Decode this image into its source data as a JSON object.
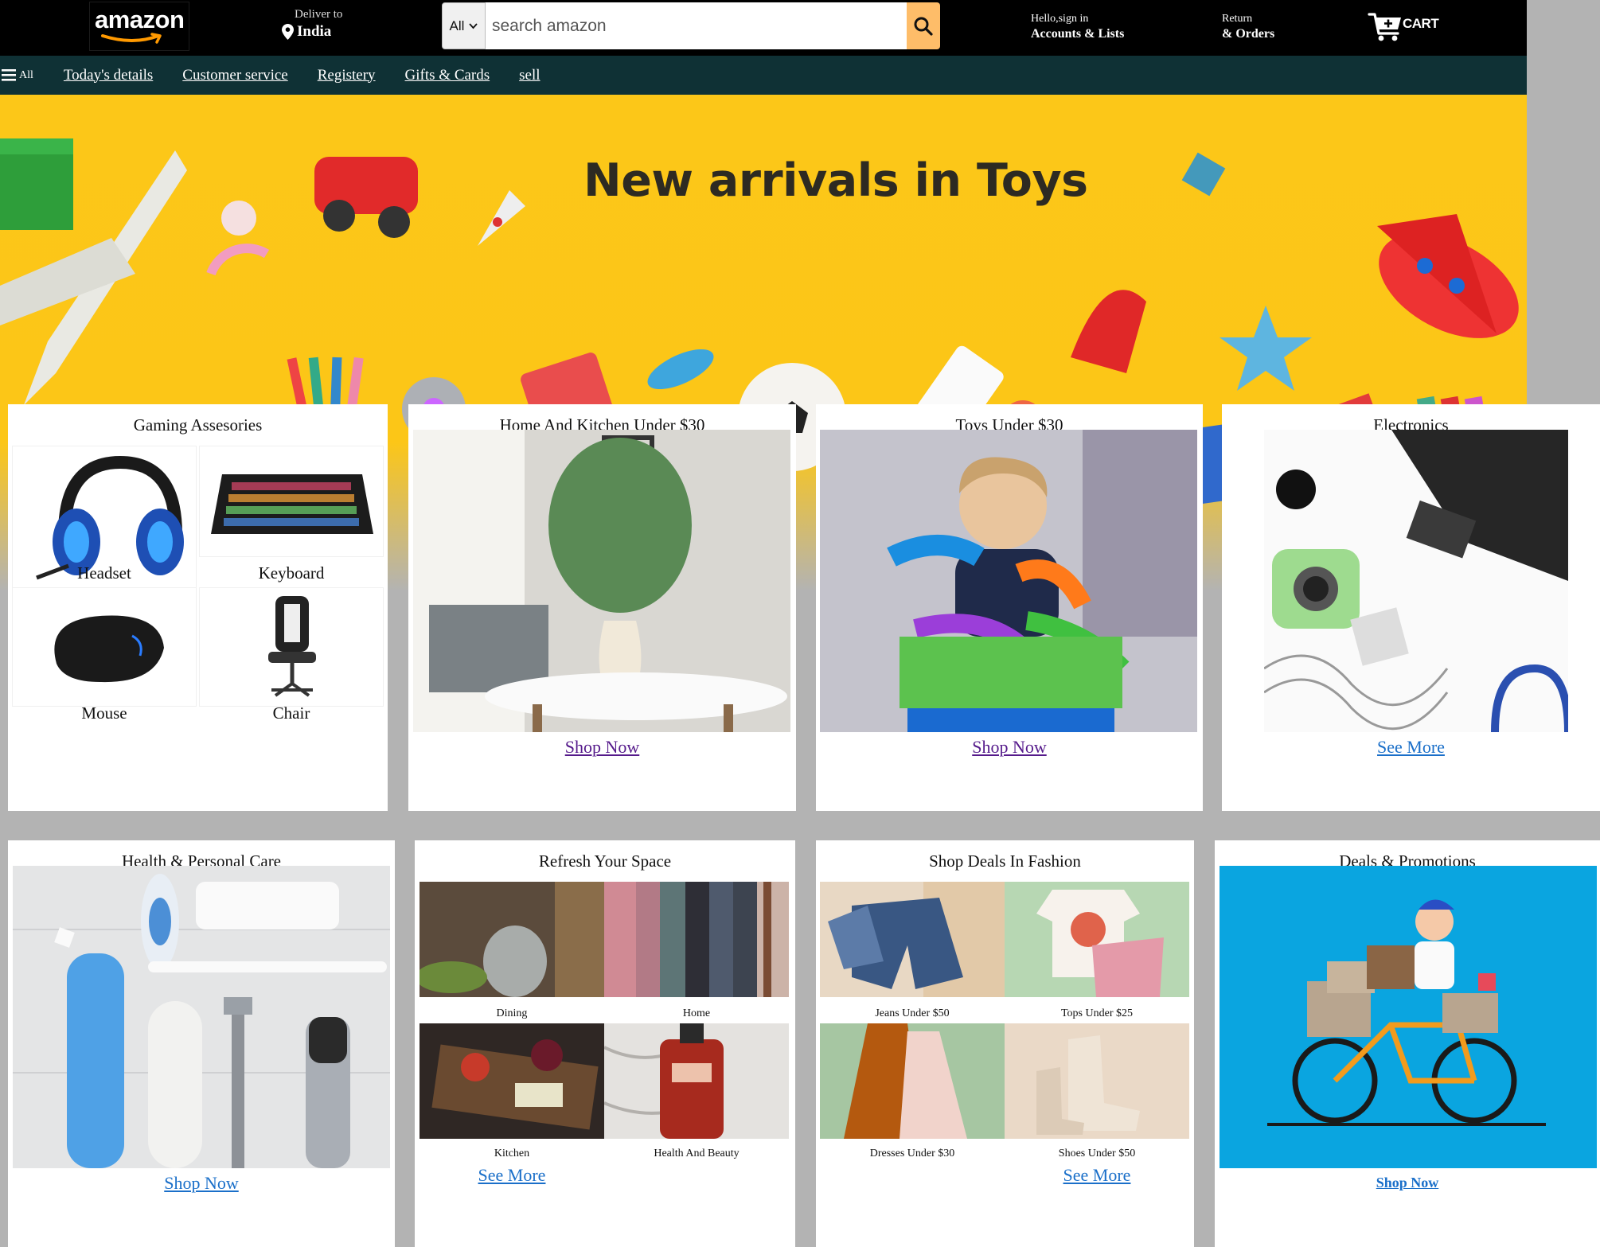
{
  "header": {
    "logo_text": "amazon",
    "deliver_label": "Deliver to",
    "deliver_location": "India",
    "search_category": "All",
    "search_placeholder": "search amazon",
    "account_line1": "Hello,sign in",
    "account_line2": "Accounts & Lists",
    "returns_line1": "Return",
    "returns_line2": "& Orders",
    "cart_label": "CART"
  },
  "subnav": {
    "all_label": "All",
    "links": [
      "Today's details",
      "Customer service",
      "Registery",
      "Gifts & Cards",
      "sell"
    ]
  },
  "hero": {
    "title": "New arrivals in Toys"
  },
  "cards": {
    "gaming": {
      "title": "Gaming Assesories",
      "items": [
        "Headset",
        "Keyboard",
        "Mouse",
        "Chair"
      ]
    },
    "home_kitchen": {
      "title": "Home And Kitchen Under $30",
      "link": "Shop Now"
    },
    "toys": {
      "title": "Toys Under $30",
      "link": "Shop Now"
    },
    "electronics": {
      "title": "Electronics",
      "link": "See More"
    },
    "health": {
      "title": "Health & Personal Care",
      "link": "Shop Now"
    },
    "refresh": {
      "title": "Refresh Your Space",
      "items": [
        "Dining",
        "Home",
        "Kitchen",
        "Health And Beauty"
      ],
      "link": "See More"
    },
    "fashion": {
      "title": "Shop Deals In Fashion",
      "items": [
        "Jeans Under $50",
        "Tops Under $25",
        "Dresses Under $30",
        "Shoes Under $50"
      ],
      "link": "See More"
    },
    "deals": {
      "title": "Deals & Promotions",
      "link": "Shop Now"
    }
  },
  "colors": {
    "nav_top": "#000000",
    "nav_sub": "#0f3135",
    "search_button": "#febd69",
    "hero_yellow": "#fcc718",
    "page_gray": "#b3b3b3",
    "link_blue": "#1a6fc9",
    "link_purple": "#551a8b",
    "deals_bg": "#0aa5e0"
  }
}
